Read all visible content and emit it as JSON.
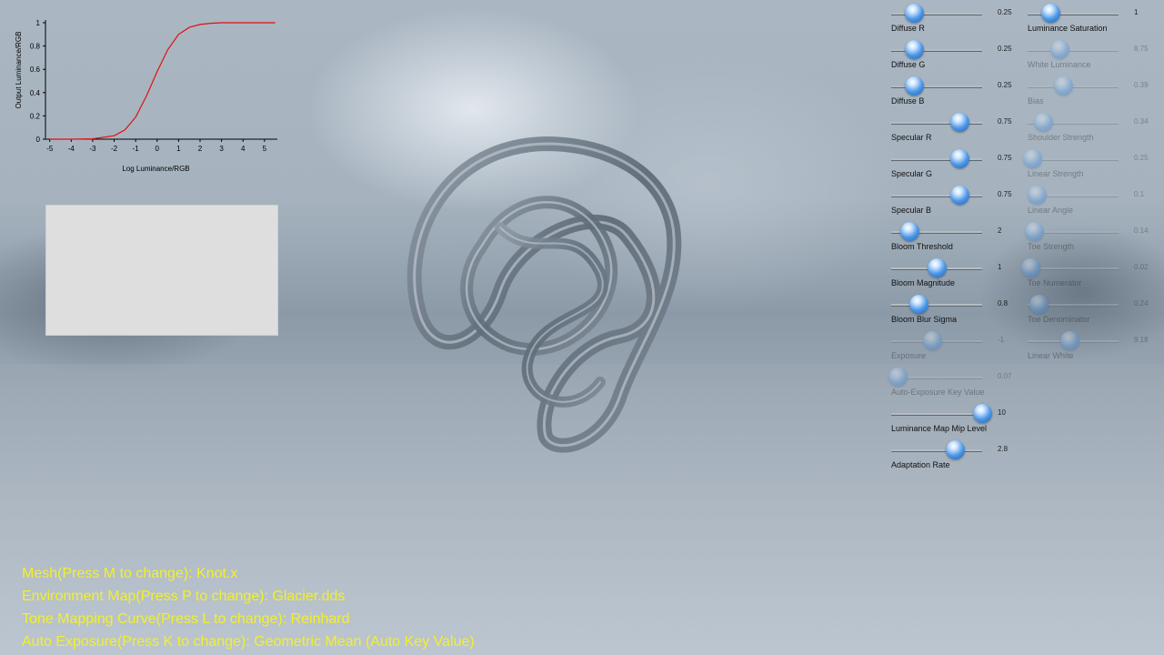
{
  "chart": {
    "x_axis_label": "Log Luminance/RGB",
    "y_axis_label": "Output Luminance/RGB",
    "x_ticks": [
      "-5",
      "-4",
      "-3",
      "-2",
      "-1",
      "0",
      "1",
      "2",
      "3",
      "4",
      "5"
    ],
    "y_ticks": [
      "0",
      "0.2",
      "0.4",
      "0.6",
      "0.8",
      "1"
    ],
    "curve_color": "#e01010"
  },
  "chart_data": {
    "type": "line",
    "title": "",
    "xlabel": "Log Luminance/RGB",
    "ylabel": "Output Luminance/RGB",
    "xlim": [
      -5.2,
      5.6
    ],
    "ylim": [
      0,
      1
    ],
    "grid": false,
    "series": [
      {
        "values_x": [
          -5,
          -4,
          -3,
          -2,
          -1.5,
          -1,
          -0.5,
          0,
          0.5,
          1,
          1.5,
          2,
          2.5,
          3,
          4,
          5,
          5.5
        ],
        "values_y": [
          0.0,
          0.0,
          0.003,
          0.03,
          0.08,
          0.19,
          0.37,
          0.58,
          0.77,
          0.9,
          0.96,
          0.985,
          0.995,
          1.0,
          1.0,
          1.0,
          1.0
        ]
      }
    ]
  },
  "sliders_left": [
    {
      "label": "Diffuse R",
      "value": "0.25",
      "fraction": 0.25,
      "enabled": true
    },
    {
      "label": "Diffuse G",
      "value": "0.25",
      "fraction": 0.25,
      "enabled": true
    },
    {
      "label": "Diffuse B",
      "value": "0.25",
      "fraction": 0.25,
      "enabled": true
    },
    {
      "label": "Specular R",
      "value": "0.75",
      "fraction": 0.75,
      "enabled": true
    },
    {
      "label": "Specular G",
      "value": "0.75",
      "fraction": 0.75,
      "enabled": true
    },
    {
      "label": "Specular B",
      "value": "0.75",
      "fraction": 0.75,
      "enabled": true
    },
    {
      "label": "Bloom Threshold",
      "value": "2",
      "fraction": 0.2,
      "enabled": true
    },
    {
      "label": "Bloom Magnitude",
      "value": "1",
      "fraction": 0.5,
      "enabled": true
    },
    {
      "label": "Bloom Blur Sigma",
      "value": "0.8",
      "fraction": 0.3,
      "enabled": true
    },
    {
      "label": "Exposure",
      "value": "-1",
      "fraction": 0.45,
      "enabled": false
    },
    {
      "label": "Auto-Exposure Key Value",
      "value": "0.07",
      "fraction": 0.07,
      "enabled": false
    },
    {
      "label": "Luminance Map Mip Level",
      "value": "10",
      "fraction": 1.0,
      "enabled": true
    },
    {
      "label": "Adaptation Rate",
      "value": "2.8",
      "fraction": 0.7,
      "enabled": true
    }
  ],
  "sliders_right": [
    {
      "label": "Luminance Saturation",
      "value": "1",
      "fraction": 0.25,
      "enabled": true
    },
    {
      "label": "White Luminance",
      "value": "8.75",
      "fraction": 0.35,
      "enabled": false
    },
    {
      "label": "Bias",
      "value": "0.39",
      "fraction": 0.39,
      "enabled": false
    },
    {
      "label": "Shoulder Strength",
      "value": "0.34",
      "fraction": 0.17,
      "enabled": false
    },
    {
      "label": "Linear Strength",
      "value": "0.25",
      "fraction": 0.05,
      "enabled": false
    },
    {
      "label": "Linear Angle",
      "value": "0.1",
      "fraction": 0.1,
      "enabled": false
    },
    {
      "label": "Toe Strength",
      "value": "0.14",
      "fraction": 0.07,
      "enabled": false
    },
    {
      "label": "Toe Numerator",
      "value": "0.02",
      "fraction": 0.03,
      "enabled": false
    },
    {
      "label": "Toe Denominator",
      "value": "0.24",
      "fraction": 0.12,
      "enabled": false
    },
    {
      "label": "Linear White",
      "value": "9.18",
      "fraction": 0.46,
      "enabled": false
    }
  ],
  "status": {
    "mesh": "Mesh(Press M to change): Knot.x",
    "env_map": "Environment Map(Press P to change): Glacier.dds",
    "tone_curve": "Tone Mapping Curve(Press L to change): Reinhard",
    "auto_exposure": "Auto Exposure(Press K to change): Geometric Mean (Auto Key Value)"
  }
}
